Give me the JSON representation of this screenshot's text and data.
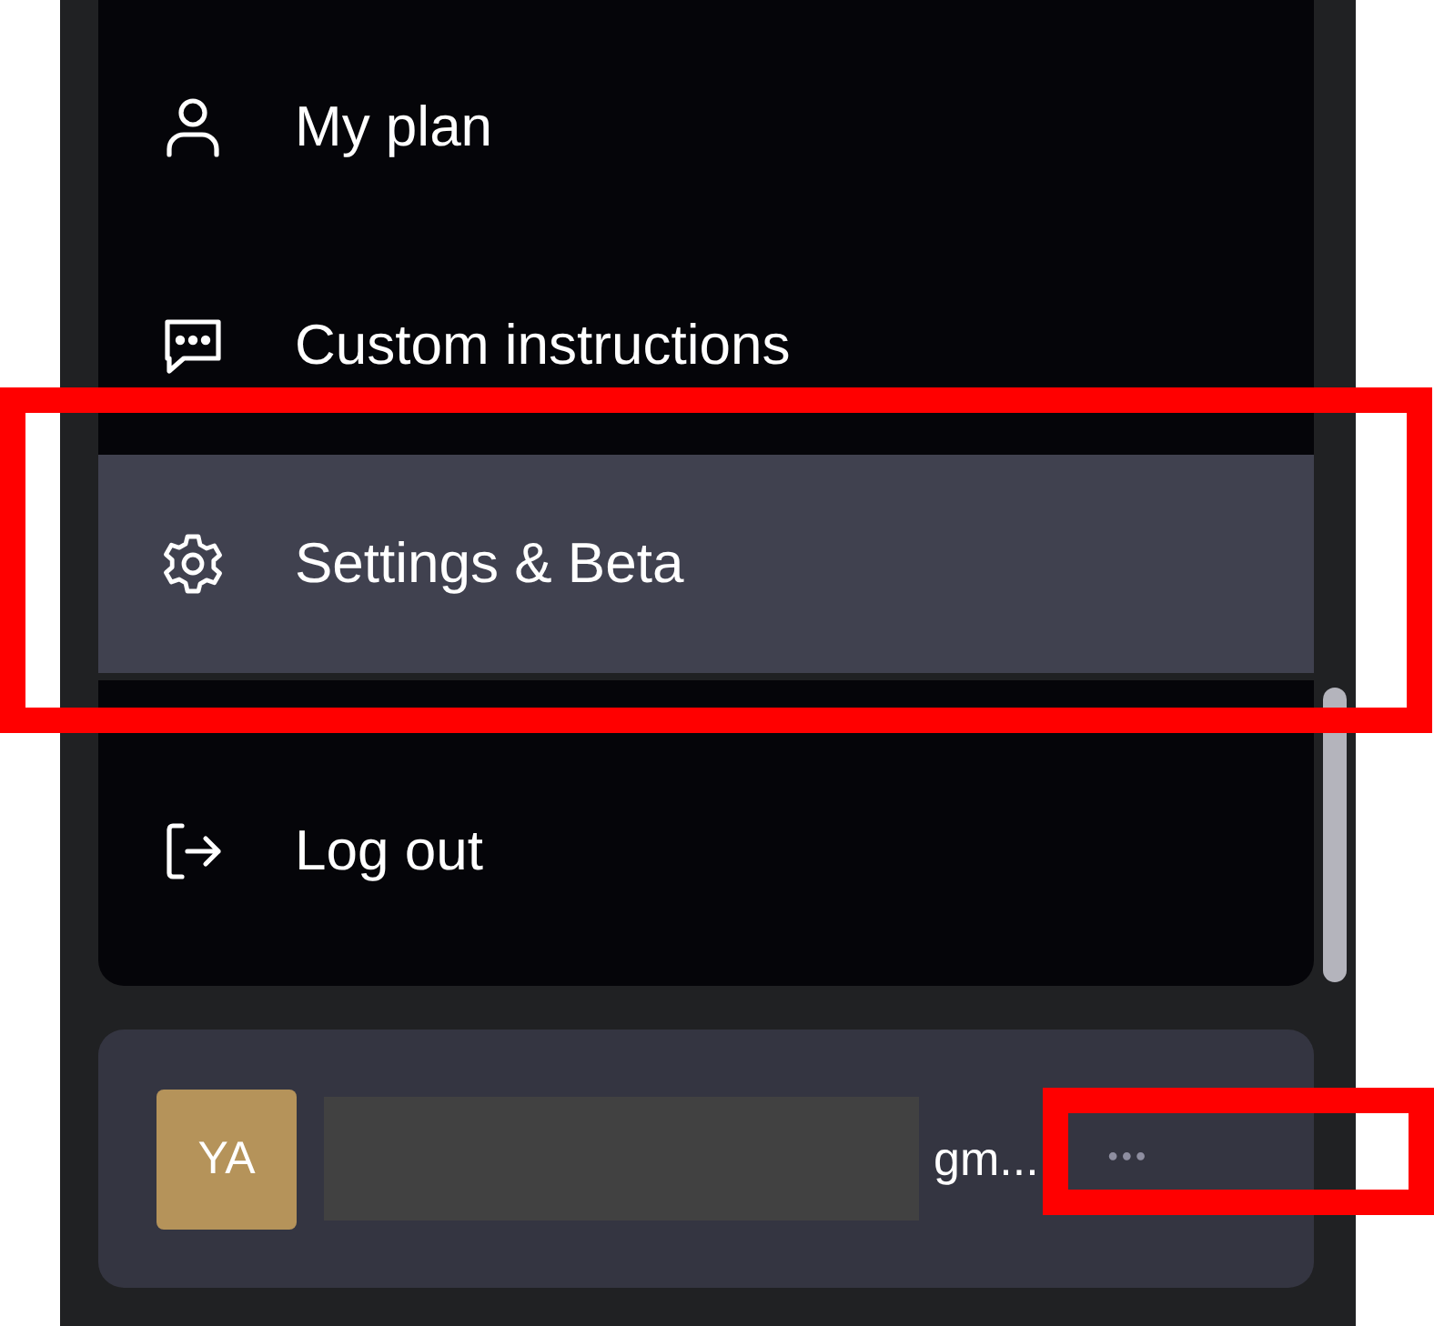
{
  "menu": {
    "items": [
      {
        "kind": "person",
        "label": "My plan",
        "selected": false
      },
      {
        "kind": "chat",
        "label": "Custom instructions",
        "selected": false
      },
      {
        "kind": "gear",
        "label": "Settings & Beta",
        "selected": true
      },
      {
        "kind": "logout",
        "label": "Log out",
        "selected": false
      }
    ]
  },
  "account": {
    "avatar": "YA",
    "name": "gm...",
    "redacted": true,
    "more": "•••"
  },
  "annotations": [
    {
      "kind": "rectangle"
    },
    {
      "kind": "rectangle"
    }
  ]
}
